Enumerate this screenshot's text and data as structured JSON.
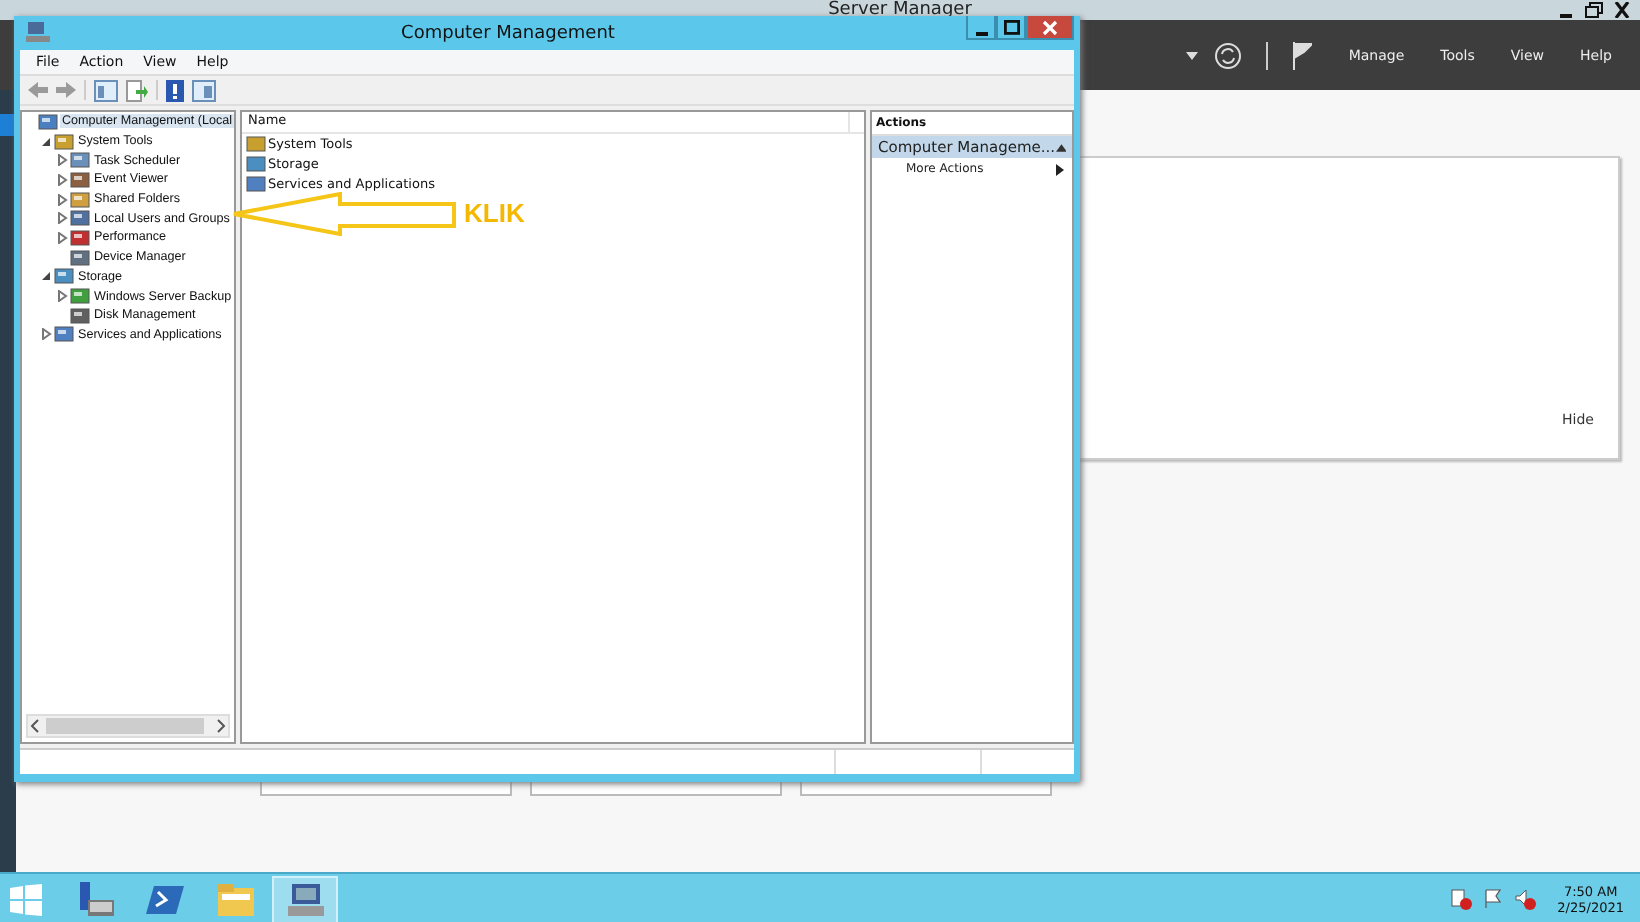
{
  "server_manager": {
    "title": "Server Manager",
    "menu": [
      "Manage",
      "Tools",
      "View",
      "Help"
    ],
    "card_link": "Hide"
  },
  "window": {
    "title": "Computer Management",
    "menu": [
      "File",
      "Action",
      "View",
      "Help"
    ],
    "tree": [
      {
        "label": "Computer Management (Local",
        "selected": true,
        "children": [
          {
            "label": "System Tools",
            "expanded": true,
            "selected": false,
            "children": [
              {
                "label": "Task Scheduler",
                "expanded": false,
                "selected": false
              },
              {
                "label": "Event Viewer",
                "expanded": false,
                "selected": false
              },
              {
                "label": "Shared Folders",
                "expanded": false,
                "selected": false
              },
              {
                "label": "Local Users and Groups",
                "expanded": false,
                "selected": false
              },
              {
                "label": "Performance",
                "expanded": false,
                "selected": false
              },
              {
                "label": "Device Manager",
                "selected": false
              }
            ]
          },
          {
            "label": "Storage",
            "expanded": true,
            "selected": false,
            "children": [
              {
                "label": "Windows Server Backup",
                "expanded": false,
                "selected": false
              },
              {
                "label": "Disk Management",
                "selected": false
              }
            ]
          },
          {
            "label": "Services and Applications",
            "expanded": false,
            "selected": false
          }
        ]
      }
    ],
    "list": {
      "columns": [
        "Name"
      ],
      "rows": [
        "System Tools",
        "Storage",
        "Services and Applications"
      ]
    },
    "actions": {
      "title": "Actions",
      "section": "Computer Manageme...",
      "items": [
        "More Actions"
      ]
    }
  },
  "annotation": {
    "text": "KLIK"
  },
  "taskbar": {
    "apps": [
      {
        "selected": false
      },
      {
        "selected": false
      },
      {
        "selected": false
      },
      {
        "selected": true
      }
    ],
    "time": "7:50 AM",
    "date": "2/25/2021"
  }
}
